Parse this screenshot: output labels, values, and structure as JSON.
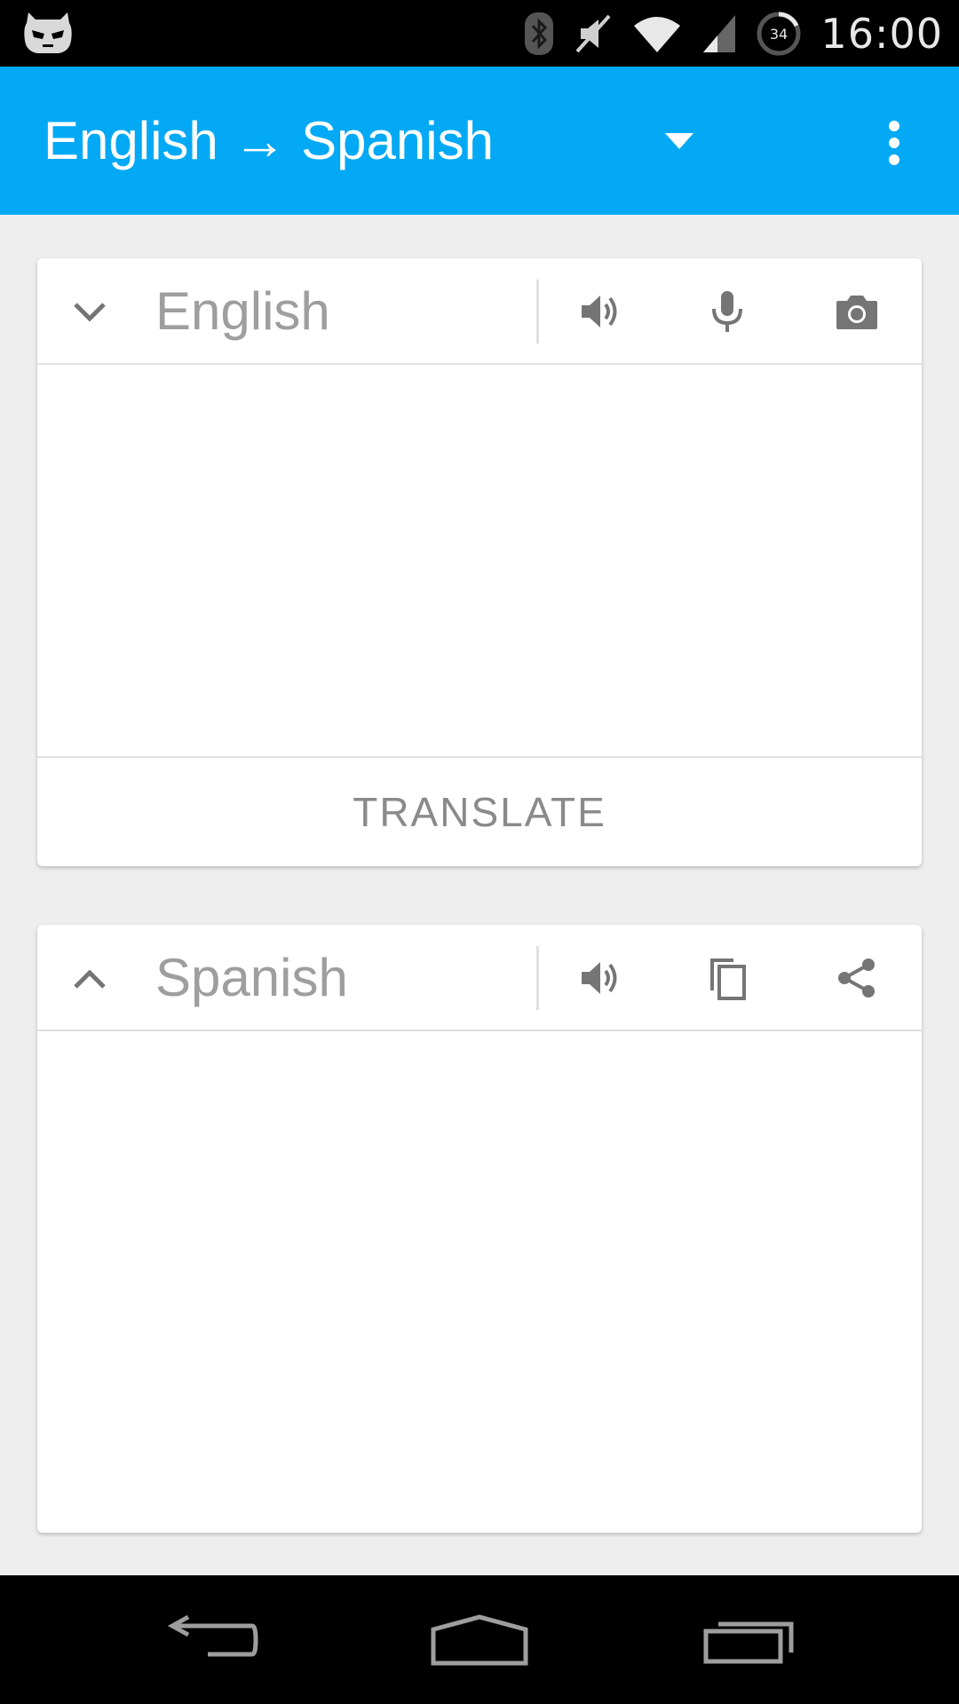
{
  "status_bar": {
    "time": "16:00",
    "battery_level": "34",
    "icons": [
      "cyanogenmod-icon",
      "bluetooth-icon",
      "mute-icon",
      "wifi-icon",
      "cell-signal-icon",
      "battery-icon"
    ]
  },
  "app_bar": {
    "title": "English → Spanish",
    "color": "#03a9f4"
  },
  "input_card": {
    "language": "English",
    "input_text": "",
    "action_label": "TRANSLATE",
    "icons": [
      "chevron-down-icon",
      "speaker-icon",
      "microphone-icon",
      "camera-icon"
    ]
  },
  "output_card": {
    "language": "Spanish",
    "output_text": "",
    "icons": [
      "chevron-up-icon",
      "speaker-icon",
      "copy-icon",
      "share-icon"
    ]
  },
  "nav_bar": {
    "icons": [
      "back-icon",
      "home-icon",
      "recents-icon"
    ]
  }
}
